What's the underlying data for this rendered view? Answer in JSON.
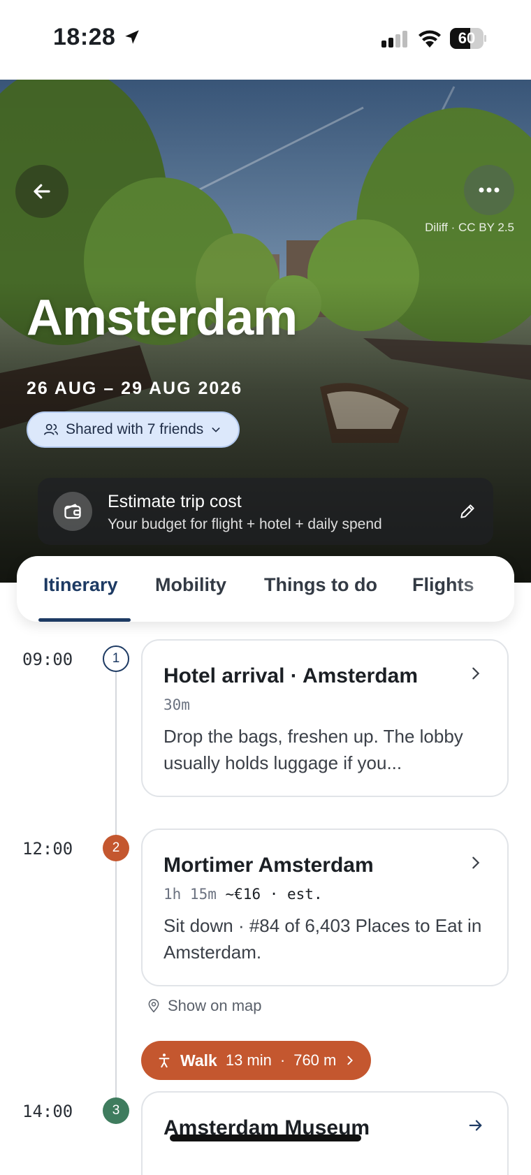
{
  "status_bar": {
    "time": "18:28",
    "battery": "60",
    "battery_level": 0.6
  },
  "hero": {
    "photo_credit": "Diliff · CC BY 2.5",
    "city": "Amsterdam",
    "dates": "26 AUG – 29 AUG 2026",
    "shared_chip": "Shared with 7 friends",
    "cost_card": {
      "title": "Estimate trip cost",
      "subtitle": "Your budget for flight + hotel + daily spend"
    }
  },
  "tabs": [
    {
      "label": "Itinerary",
      "active": true
    },
    {
      "label": "Mobility",
      "active": false
    },
    {
      "label": "Things to do",
      "active": false
    },
    {
      "label": "Flights",
      "active": false
    }
  ],
  "itinerary": [
    {
      "time": "09:00",
      "step": "1",
      "title": "Hotel arrival · Amsterdam",
      "duration": "30m",
      "price": "",
      "description": "Drop the bags, freshen up. The lobby usually holds luggage if you..."
    },
    {
      "time": "12:00",
      "step": "2",
      "title": "Mortimer Amsterdam",
      "duration": "1h 15m",
      "price": "~€16 · est.",
      "description": "Sit down · #84 of 6,403 Places to Eat in Amsterdam.",
      "map_link": "Show on map"
    },
    {
      "time": "14:00",
      "step": "3",
      "title": "Amsterdam Museum",
      "duration": "",
      "price": "",
      "description": ""
    }
  ],
  "walk": {
    "label": "Walk",
    "duration": "13 min",
    "separator": "·",
    "distance": "760 m"
  },
  "colors": {
    "accent": "#1d3a63",
    "orange": "#c4572f",
    "green": "#3f7c5e",
    "chip_bg": "#dce8fb"
  },
  "icons": [
    "location-arrow-icon",
    "signal-icon",
    "wifi-icon",
    "battery-icon",
    "back-arrow-icon",
    "more-icon",
    "users-icon",
    "chevron-down-icon",
    "wallet-icon",
    "pencil-icon",
    "chevron-right-icon",
    "arrow-right-icon",
    "map-pin-icon",
    "walk-icon"
  ]
}
